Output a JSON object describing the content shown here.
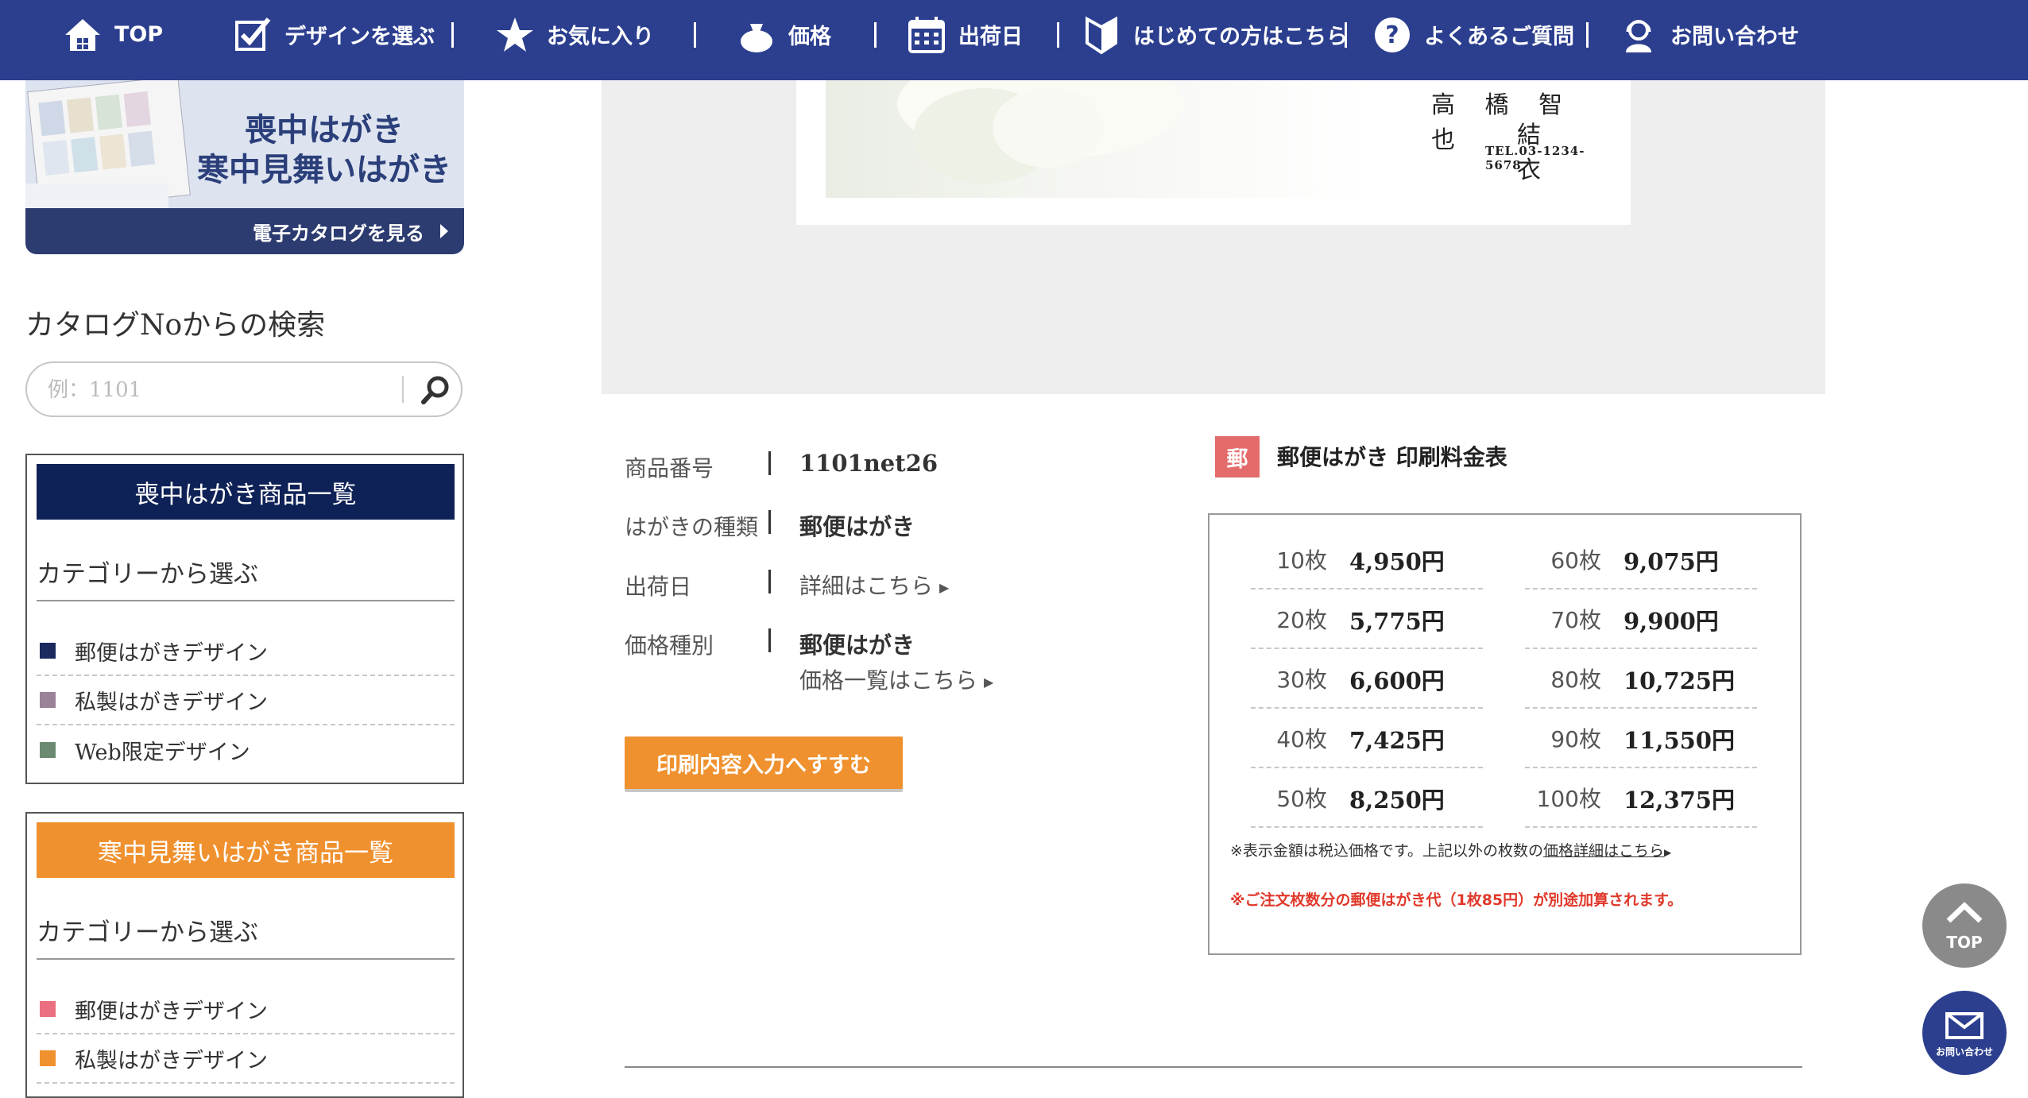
{
  "nav": {
    "items": [
      {
        "label": "TOP",
        "icon": "home-icon"
      },
      {
        "label": "デザインを選ぶ",
        "icon": "checkbox-icon"
      },
      {
        "label": "お気に入り",
        "icon": "star-icon"
      },
      {
        "label": "価格",
        "icon": "money-bag-icon"
      },
      {
        "label": "出荷日",
        "icon": "calendar-icon"
      },
      {
        "label": "はじめての方はこちら",
        "icon": "beginner-mark-icon"
      },
      {
        "label": "よくあるご質問",
        "icon": "question-icon"
      },
      {
        "label": "お問い合わせ",
        "icon": "operator-icon"
      }
    ]
  },
  "sidebar": {
    "banner": {
      "title_line1": "喪中はがき",
      "title_line2": "寒中見舞いはがき",
      "link": "電子カタログを見る"
    },
    "catalog_search": {
      "heading": "カタログNoからの検索",
      "placeholder": "例：1101"
    },
    "mochu": {
      "header": "喪中はがき商品一覧",
      "sub": "カテゴリーから選ぶ",
      "items": [
        {
          "label": "郵便はがきデザイン",
          "color": "#1b2a5e"
        },
        {
          "label": "私製はがきデザイン",
          "color": "#9a8299"
        },
        {
          "label": "Web限定デザイン",
          "color": "#6c8a72"
        }
      ]
    },
    "kanchu": {
      "header": "寒中見舞いはがき商品一覧",
      "sub": "カテゴリーから選ぶ",
      "items": [
        {
          "label": "郵便はがきデザイン",
          "color": "#ea7080"
        },
        {
          "label": "私製はがきデザイン",
          "color": "#f0912f"
        }
      ]
    }
  },
  "preview": {
    "name1": "高 橋 智 也",
    "name2": "結 衣",
    "tel": "TEL.03-1234-5678"
  },
  "product": {
    "fields": [
      {
        "label": "商品番号",
        "value": "1101net26"
      },
      {
        "label": "はがきの種類",
        "value": "郵便はがき"
      },
      {
        "label": "出荷日",
        "link": "詳細はこちら"
      },
      {
        "label": "価格種別",
        "value": "郵便はがき",
        "link": "価格一覧はこちら"
      }
    ],
    "proceed_label": "印刷内容入力へすすむ"
  },
  "price_table": {
    "badge": "郵",
    "title": "郵便はがき 印刷料金表",
    "rows_left": [
      {
        "count": "10枚",
        "price": "4,950円"
      },
      {
        "count": "20枚",
        "price": "5,775円"
      },
      {
        "count": "30枚",
        "price": "6,600円"
      },
      {
        "count": "40枚",
        "price": "7,425円"
      },
      {
        "count": "50枚",
        "price": "8,250円"
      }
    ],
    "rows_right": [
      {
        "count": "60枚",
        "price": "9,075円"
      },
      {
        "count": "70枚",
        "price": "9,900円"
      },
      {
        "count": "80枚",
        "price": "10,725円"
      },
      {
        "count": "90枚",
        "price": "11,550円"
      },
      {
        "count": "100枚",
        "price": "12,375円"
      }
    ],
    "note": "※表示金額は税込価格です。上記以外の枚数の",
    "note_link": "価格詳細はこちら",
    "warning": "※ご注文枚数分の郵便はがき代（1枚85円）が別途加算されます。"
  },
  "floating": {
    "top_label": "TOP",
    "contact_label": "お問い合わせ"
  },
  "colors": {
    "nav_bg": "#2c3f8f",
    "accent_orange": "#f0912f",
    "navy": "#0f2257",
    "warning_red": "#e0392b"
  }
}
